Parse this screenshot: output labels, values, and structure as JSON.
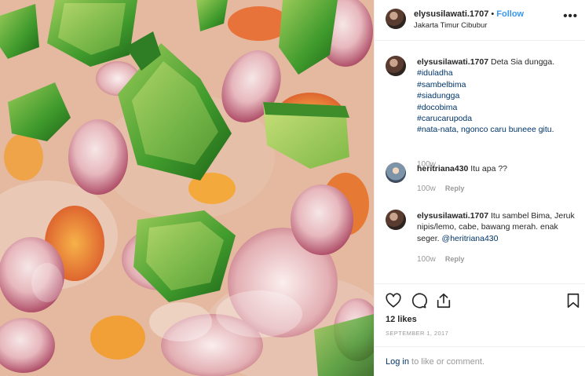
{
  "post": {
    "username": "elysusilawati.1707",
    "separator": "•",
    "follow_label": "Follow",
    "location": "Jakarta Timur Cibubur",
    "more_icon": "more-horizontal-icon",
    "more_glyph": "•••"
  },
  "caption": {
    "username": "elysusilawati.1707",
    "text": "Deta Sia dungga.",
    "hashtags": [
      "#iduladha",
      "#sambelbima",
      "#siadungga",
      "#docobima",
      "#carucarupoda"
    ],
    "last_line": "#nata-nata, ngonco caru buneee gitu.",
    "time": "100w"
  },
  "comments": [
    {
      "username": "heritriana430",
      "text": "Itu apa ??",
      "time": "100w",
      "reply_label": "Reply"
    },
    {
      "username": "elysusilawati.1707",
      "text": "Itu sambel Bima, Jeruk nipis/lemo, cabe, bawang merah. enak seger.",
      "mention": "@heritriana430",
      "time": "100w",
      "reply_label": "Reply"
    }
  ],
  "actions": {
    "icons": [
      "heart-icon",
      "comment-icon",
      "share-icon",
      "bookmark-icon"
    ]
  },
  "likes_text": "12 likes",
  "date_text": "SEPTEMBER 1, 2017",
  "login": {
    "link_label": "Log in",
    "rest": "to like or comment."
  },
  "colors": {
    "link": "#003569",
    "follow": "#3897f0",
    "muted": "#999999"
  }
}
